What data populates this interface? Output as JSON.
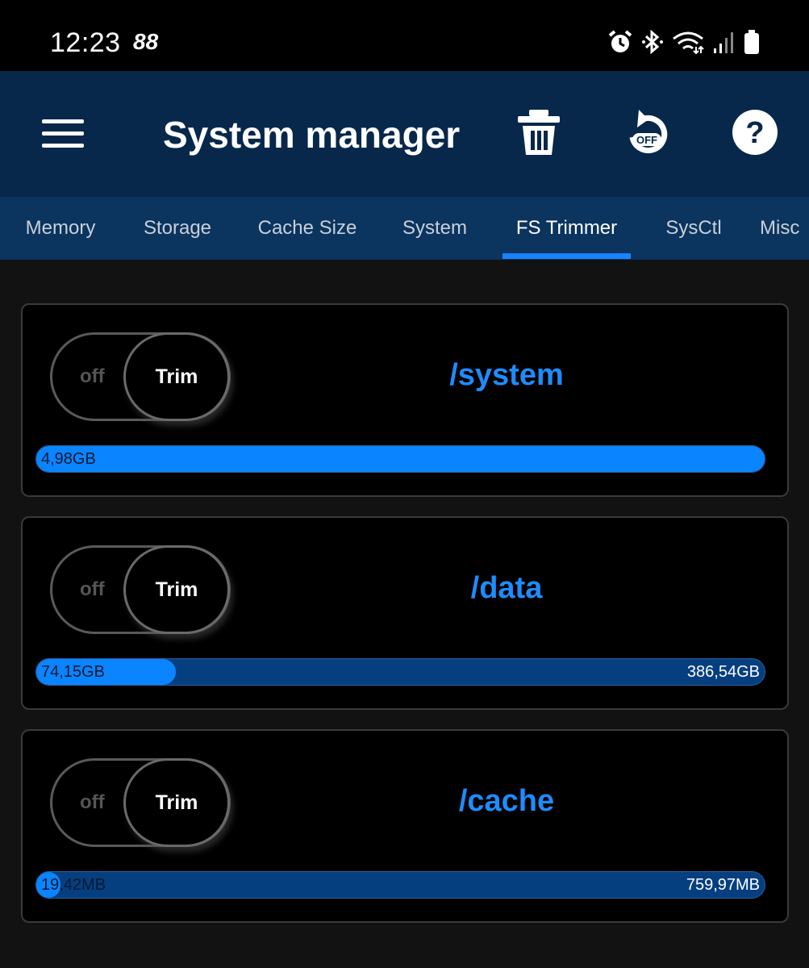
{
  "status_bar": {
    "time": "12:23",
    "notification_glyph": "88",
    "icons": [
      "alarm-icon",
      "bluetooth-icon",
      "wifi-icon",
      "signal-icon",
      "battery-icon"
    ]
  },
  "app_bar": {
    "title": "System manager",
    "actions": [
      "menu-icon",
      "trash-icon",
      "reset-off-icon",
      "help-icon"
    ],
    "reset_badge": "OFF",
    "help_glyph": "?"
  },
  "tabs": [
    {
      "label": "Memory",
      "active": false
    },
    {
      "label": "Storage",
      "active": false
    },
    {
      "label": "Cache Size",
      "active": false
    },
    {
      "label": "System",
      "active": false
    },
    {
      "label": "FS Trimmer",
      "active": true
    },
    {
      "label": "SysCtl",
      "active": false
    },
    {
      "label": "Misc",
      "active": false
    }
  ],
  "partitions": [
    {
      "mount": "/system",
      "toggle_off": "off",
      "toggle_on": "Trim",
      "used": "4,98GB",
      "total": "",
      "used_fraction": 1.0
    },
    {
      "mount": "/data",
      "toggle_off": "off",
      "toggle_on": "Trim",
      "used": "74,15GB",
      "total": "386,54GB",
      "used_fraction": 0.1918
    },
    {
      "mount": "/cache",
      "toggle_off": "off",
      "toggle_on": "Trim",
      "used": "19,42MB",
      "total": "759,97MB",
      "used_fraction": 0.0256
    }
  ],
  "colors": {
    "app_bar": "#07284a",
    "tab_bar": "#0b345f",
    "accent": "#1a82ff",
    "bar_track": "#063f80",
    "bar_fill": "#0a84ff"
  }
}
